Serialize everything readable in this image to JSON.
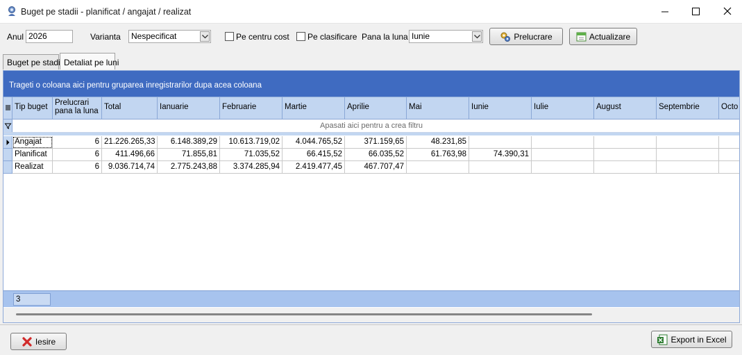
{
  "window": {
    "title": "Buget pe stadii - planificat / angajat / realizat",
    "buttons": {
      "minimize": "minimize",
      "maximize": "maximize",
      "close": "close"
    }
  },
  "toolbar": {
    "year_label": "Anul",
    "year_value": "2026",
    "variant_label": "Varianta",
    "variant_value": "Nespecificat",
    "per_cost_center_label": "Pe centru cost",
    "per_cost_center_checked": false,
    "per_classification_label": "Pe clasificare",
    "per_classification_checked": false,
    "until_month_label": "Pana la luna",
    "until_month_value": "Iunie",
    "process_button": "Prelucrare",
    "update_button": "Actualizare"
  },
  "tabs": [
    {
      "label": "Buget pe stadii",
      "active": false
    },
    {
      "label": "Detaliat pe luni",
      "active": true
    }
  ],
  "grid": {
    "group_panel_text": "Trageti o coloana aici pentru gruparea inregistrarilor dupa acea coloana",
    "filter_text": "Apasati aici pentru a  crea filtru",
    "columns": [
      "Tip buget",
      "Prelucrari pana la luna",
      "Total",
      "Ianuarie",
      "Februarie",
      "Martie",
      "Aprilie",
      "Mai",
      "Iunie",
      "Iulie",
      "August",
      "Septembrie",
      "Octombrie"
    ],
    "header": {
      "c0": "Tip buget",
      "c1a": "Prelucrari",
      "c1b": "pana la luna",
      "c2": "Total",
      "c3": "Ianuarie",
      "c4": "Februarie",
      "c5": "Martie",
      "c6": "Aprilie",
      "c7": "Mai",
      "c8": "Iunie",
      "c9": "Iulie",
      "c10": "August",
      "c11": "Septembrie",
      "c12": "Octo"
    },
    "rows": [
      [
        "Angajat",
        "6",
        "21.226.265,33",
        "6.148.389,29",
        "10.613.719,02",
        "4.044.765,52",
        "371.159,65",
        "48.231,85",
        "",
        "",
        "",
        "",
        ""
      ],
      [
        "Planificat",
        "6",
        "411.496,66",
        "71.855,81",
        "71.035,52",
        "66.415,52",
        "66.035,52",
        "61.763,98",
        "74.390,31",
        "",
        "",
        "",
        ""
      ],
      [
        "Realizat",
        "6",
        "9.036.714,74",
        "2.775.243,88",
        "3.374.285,94",
        "2.419.477,45",
        "467.707,47",
        "",
        "",
        "",
        "",
        "",
        ""
      ]
    ],
    "footer_count": "3"
  },
  "bottom": {
    "exit_button": "Iesire",
    "export_button": "Export in Excel"
  },
  "colors": {
    "group_panel": "#3f6bc1",
    "header_bg": "#c2d6f1",
    "footer_bg": "#a7c3ee"
  }
}
